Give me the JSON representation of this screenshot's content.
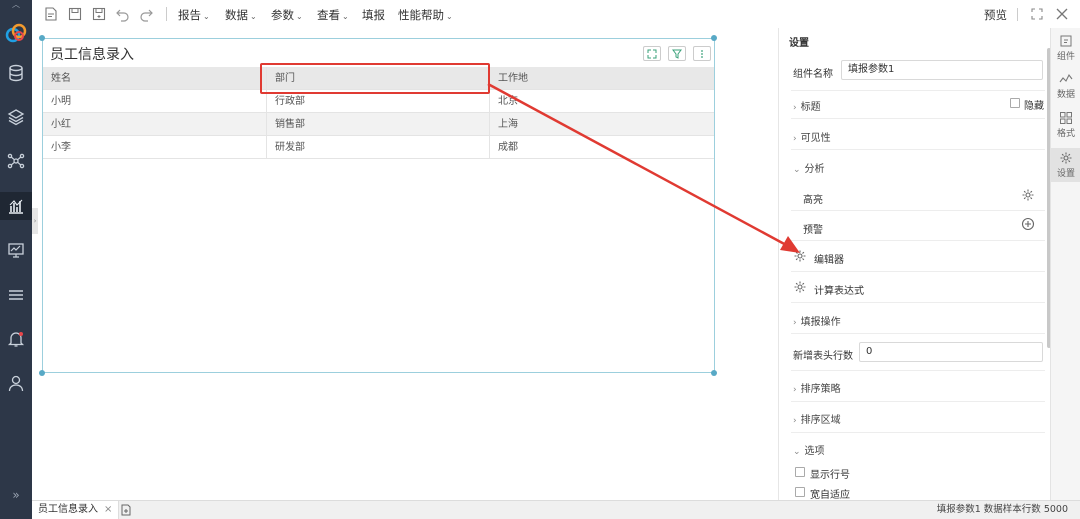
{
  "toolbar": {
    "menus": [
      "报告",
      "数据",
      "参数",
      "查看",
      "填报",
      "性能帮助"
    ],
    "preview": "预览"
  },
  "widget": {
    "title": "员工信息录入",
    "table": {
      "headers": [
        "姓名",
        "部门",
        "工作地"
      ],
      "rows": [
        [
          "小明",
          "行政部",
          "北京"
        ],
        [
          "小红",
          "销售部",
          "上海"
        ],
        [
          "小李",
          "研发部",
          "成都"
        ]
      ]
    }
  },
  "panel": {
    "title": "设置",
    "component_name_label": "组件名称",
    "component_name_value": "填报参数1",
    "sections": {
      "title": "标题",
      "hide": "隐藏",
      "visibility": "可见性",
      "analysis": "分析",
      "highlight": "高亮",
      "warning": "预警",
      "editor": "编辑器",
      "calc_expr": "计算表达式",
      "fill_ops": "填报操作",
      "new_header_rows_label": "新增表头行数",
      "new_header_rows_value": "0",
      "sort_strategy": "排序策略",
      "sort_area": "排序区域",
      "options": "选项",
      "show_row_no": "显示行号",
      "width_adapt": "宽自适应"
    }
  },
  "rightrail": [
    "组件",
    "数据",
    "格式",
    "设置"
  ],
  "statusbar": {
    "sheet_tab": "员工信息录入",
    "close": "×",
    "right_text": "填报参数1   数据样本行数 5000"
  },
  "colors": {
    "sidebar": "#2d3748",
    "annotation_red": "#e03a32",
    "selection": "#9ccfdd"
  }
}
